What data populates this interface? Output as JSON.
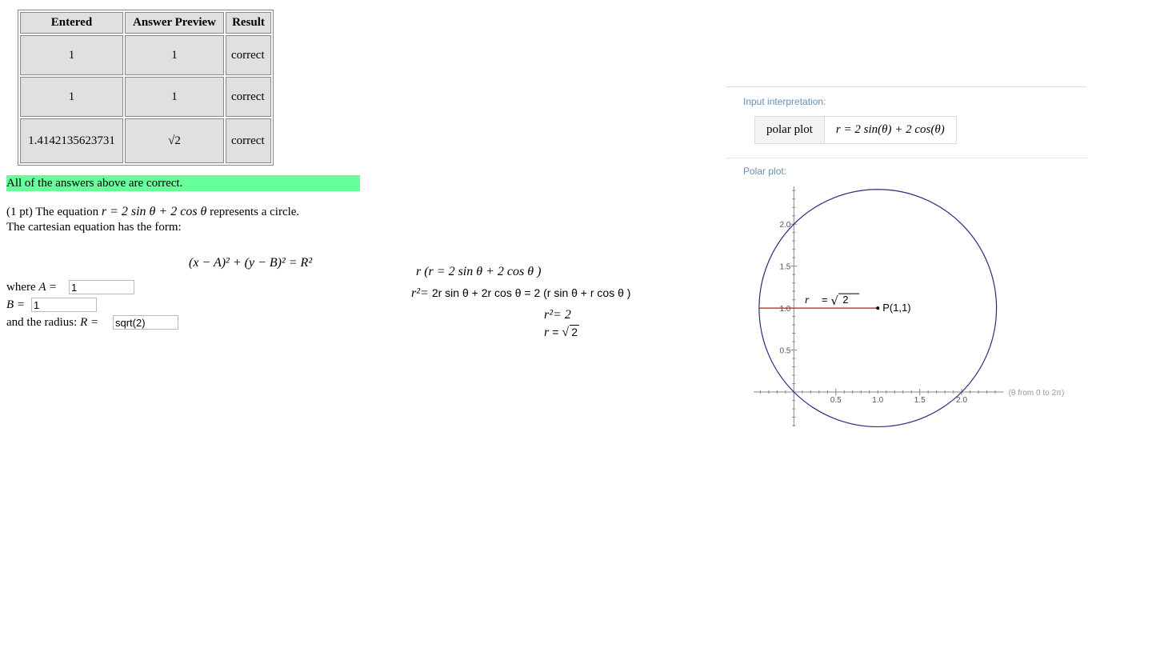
{
  "results_table": {
    "headers": [
      "Entered",
      "Answer Preview",
      "Result"
    ],
    "rows": [
      {
        "entered": "1",
        "preview": "1",
        "result": "correct"
      },
      {
        "entered": "1",
        "preview": "1",
        "result": "correct"
      },
      {
        "entered": "1.4142135623731",
        "preview": "√2",
        "result": "correct"
      }
    ]
  },
  "status_banner": "All of the answers above are correct.",
  "problem": {
    "points": "(1 pt) The equation",
    "equation": "r = 2 sin θ + 2 cos θ",
    "represents": "represents a circle.",
    "line2": "The cartesian equation has the form:",
    "form": "(x − A)² + (y − B)² = R²",
    "where_label": "where",
    "A_label": "A =",
    "A_value": "1",
    "B_label": "B =",
    "B_value": "1",
    "radius_label": "and the radius:",
    "R_label": "R =",
    "R_value": "sqrt(2)"
  },
  "scratch": {
    "line1": "r (r = 2 sin θ + 2 cos θ )",
    "line2_left": "r²=",
    "line2_mid": "2r sin θ  +  2r cos θ   =   2 (r sin θ +  r cos θ )",
    "line3": "r²=  2",
    "line4_r": "r",
    "line4_eq": "=",
    "line4_sqrt": "2"
  },
  "wolfram": {
    "input_interpretation_label": "Input interpretation:",
    "input_cell1": "polar plot",
    "input_cell2": "r = 2 sin(θ) + 2 cos(θ)",
    "polar_plot_label": "Polar plot:",
    "range_note": "(θ from 0 to 2π)",
    "annotation_r": "r",
    "annotation_eq": "=",
    "annotation_sqrt": "2",
    "point_label": "P(1,1)",
    "curve_color": "#2b2b7a",
    "radius_color": "#aa2222"
  },
  "chart_data": {
    "type": "line",
    "title": "",
    "equation": "r = 2 sin(θ) + 2 cos(θ)",
    "center": [
      1,
      1
    ],
    "radius": 1.4142,
    "x_ticks": [
      "0.5",
      "1.0",
      "1.5",
      "2.0"
    ],
    "y_ticks": [
      "0.5",
      "1.0",
      "1.5",
      "2.0"
    ],
    "xlim": [
      -0.48,
      2.5
    ],
    "ylim": [
      -0.41,
      2.45
    ],
    "grid": false
  }
}
